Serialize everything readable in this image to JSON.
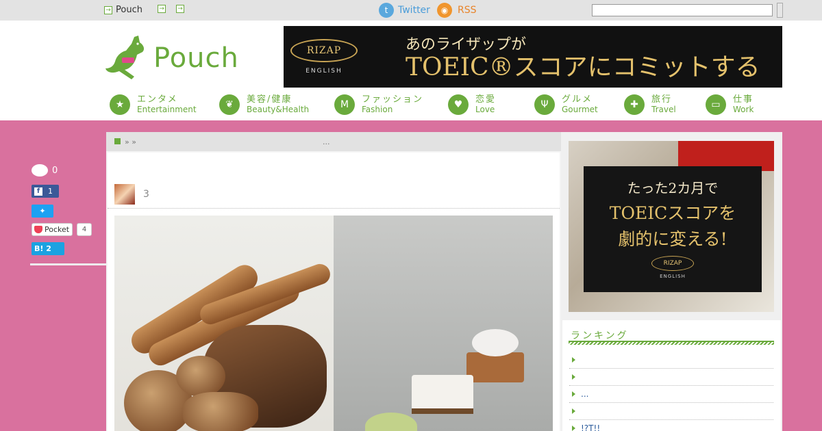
{
  "topbar": {
    "site_link": "Pouch",
    "twitter": "Twitter",
    "rss": "RSS"
  },
  "header": {
    "logo": "Pouch",
    "banner": {
      "badge": "RIZAP",
      "badge_sub": "ENGLISH",
      "line1": "あのライザップが",
      "line2": "TOEIC®スコアにコミットする"
    },
    "categories": [
      {
        "ja": "エンタメ",
        "en": "Entertainment"
      },
      {
        "ja": "美容/健康",
        "en": "Beauty&Health"
      },
      {
        "ja": "ファッション",
        "en": "Fashion"
      },
      {
        "ja": "恋愛",
        "en": "Love"
      },
      {
        "ja": "グルメ",
        "en": "Gourmet"
      },
      {
        "ja": "旅行",
        "en": "Travel"
      },
      {
        "ja": "仕事",
        "en": "Work"
      }
    ]
  },
  "share": {
    "comments": "0",
    "facebook": "1",
    "pocket_label": "Pocket",
    "pocket": "4",
    "hatena_label": "B!",
    "hatena": "2"
  },
  "article": {
    "breadcrumb_sep": "» »",
    "breadcrumb_title": "...",
    "author_count": "3"
  },
  "sidebar": {
    "ad": {
      "line1": "たった2カ月で",
      "line2": "TOEICスコアを",
      "line3": "劇的に変える!",
      "badge": "RIZAP",
      "badge_sub": "ENGLISH"
    },
    "title": "ランキング",
    "items": [
      "",
      "",
      "...",
      "",
      "!?T!!"
    ]
  }
}
